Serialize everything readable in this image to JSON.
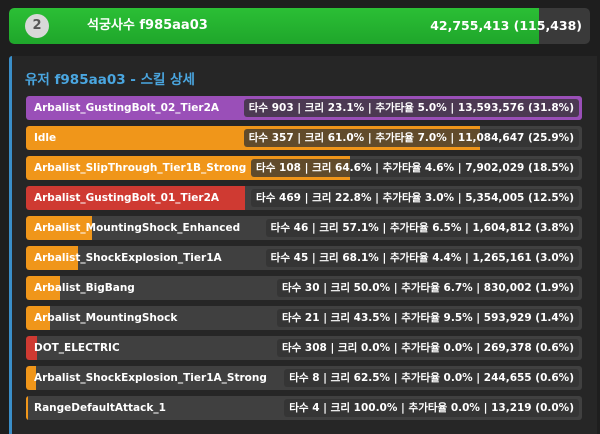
{
  "player": {
    "rank": "2",
    "name": "석궁사수 f985aa03",
    "stats": "42,755,413 (115,438)",
    "fill_fraction": 0.912,
    "bar_color": "#2bbf35"
  },
  "detail": {
    "title": "유저 f985aa03 - 스킬 상세",
    "accent_color": "#3a8ec8"
  },
  "skills": [
    {
      "name": "Arbalist_GustingBolt_02_Tier2A",
      "stats": "타수 903 | 크리 23.1% | 추가타율 5.0% | 13,593,576 (31.8%)",
      "fill_fraction": 1.0,
      "color": "#9a4fb8"
    },
    {
      "name": "Idle",
      "stats": "타수 357 | 크리 61.0% | 추가타율 7.0% | 11,084,647 (25.9%)",
      "fill_fraction": 0.816,
      "color": "#f0961a"
    },
    {
      "name": "Arbalist_SlipThrough_Tier1B_Strong",
      "stats": "타수 108 | 크리 64.6% | 추가타율 4.6% | 7,902,029 (18.5%)",
      "fill_fraction": 0.582,
      "color": "#f0961a"
    },
    {
      "name": "Arbalist_GustingBolt_01_Tier2A",
      "stats": "타수 469 | 크리 22.8% | 추가타율 3.0% | 5,354,005 (12.5%)",
      "fill_fraction": 0.394,
      "color": "#cf3a32"
    },
    {
      "name": "Arbalist_MountingShock_Enhanced",
      "stats": "타수 46 | 크리 57.1% | 추가타율 6.5% | 1,604,812 (3.8%)",
      "fill_fraction": 0.118,
      "color": "#f0961a"
    },
    {
      "name": "Arbalist_ShockExplosion_Tier1A",
      "stats": "타수 45 | 크리 68.1% | 추가타율 4.4% | 1,265,161 (3.0%)",
      "fill_fraction": 0.093,
      "color": "#f0961a"
    },
    {
      "name": "Arbalist_BigBang",
      "stats": "타수 30 | 크리 50.0% | 추가타율 6.7% | 830,002 (1.9%)",
      "fill_fraction": 0.061,
      "color": "#f0961a"
    },
    {
      "name": "Arbalist_MountingShock",
      "stats": "타수 21 | 크리 43.5% | 추가타율 9.5% | 593,929 (1.4%)",
      "fill_fraction": 0.044,
      "color": "#f0961a"
    },
    {
      "name": "DOT_ELECTRIC",
      "stats": "타수 308 | 크리 0.0% | 추가타율 0.0% | 269,378 (0.6%)",
      "fill_fraction": 0.02,
      "color": "#cf3a32"
    },
    {
      "name": "Arbalist_ShockExplosion_Tier1A_Strong",
      "stats": "타수 8 | 크리 62.5% | 추가타율 0.0% | 244,655 (0.6%)",
      "fill_fraction": 0.018,
      "color": "#f0961a"
    },
    {
      "name": "RangeDefaultAttack_1",
      "stats": "타수 4 | 크리 100.0% | 추가타율 0.0% | 13,219 (0.0%)",
      "fill_fraction": 0.001,
      "color": "#f0961a"
    }
  ]
}
